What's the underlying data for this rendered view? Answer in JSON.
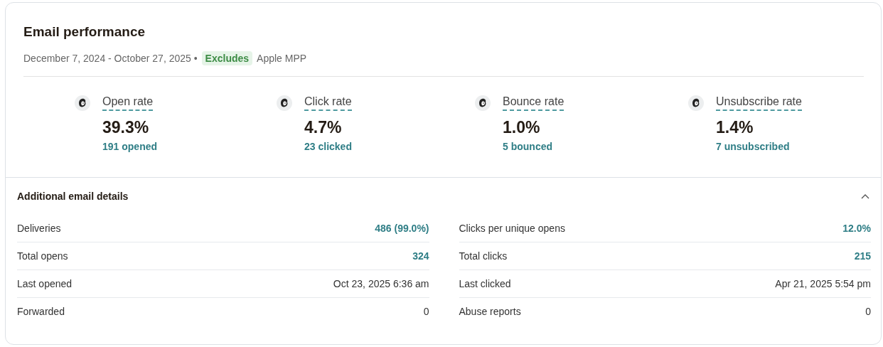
{
  "title": "Email performance",
  "date_range": "December 7, 2024 - October 27, 2025 •",
  "filter_badge": "Excludes",
  "filter_label": "Apple MPP",
  "metrics": [
    {
      "label": "Open rate",
      "value": "39.3%",
      "detail": "191 opened"
    },
    {
      "label": "Click rate",
      "value": "4.7%",
      "detail": "23 clicked"
    },
    {
      "label": "Bounce rate",
      "value": "1.0%",
      "detail": "5 bounced"
    },
    {
      "label": "Unsubscribe rate",
      "value": "1.4%",
      "detail": "7 unsubscribed"
    }
  ],
  "details": {
    "title": "Additional email details",
    "expanded": true,
    "columns": [
      [
        {
          "label": "Deliveries",
          "value": "486 (99.0%)",
          "kind": "link"
        },
        {
          "label": "Total opens",
          "value": "324",
          "kind": "link"
        },
        {
          "label": "Last opened",
          "value": "Oct 23, 2025 6:36 am",
          "kind": "text"
        },
        {
          "label": "Forwarded",
          "value": "0",
          "kind": "text"
        }
      ],
      [
        {
          "label": "Clicks per unique opens",
          "value": "12.0%",
          "kind": "link"
        },
        {
          "label": "Total clicks",
          "value": "215",
          "kind": "link"
        },
        {
          "label": "Last clicked",
          "value": "Apr 21, 2025 5:54 pm",
          "kind": "text"
        },
        {
          "label": "Abuse reports",
          "value": "0",
          "kind": "text"
        }
      ]
    ]
  }
}
